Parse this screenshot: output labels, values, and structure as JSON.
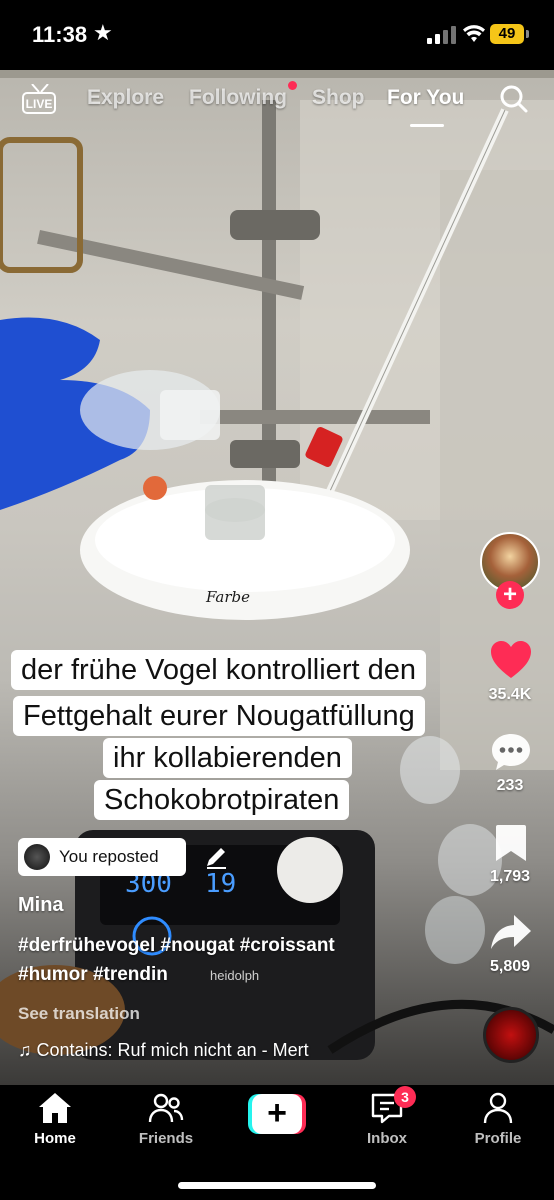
{
  "status_bar": {
    "time": "11:38",
    "battery": "49"
  },
  "top_nav": {
    "live_label": "LIVE",
    "tabs": [
      "Explore",
      "Following",
      "Shop",
      "For You"
    ],
    "active_tab": "For You"
  },
  "caption_lines": [
    "der frühe Vogel kontrolliert den",
    "Fettgehalt eurer Nougatfüllung",
    "ihr kollabierenden",
    "Schokobrotpiraten"
  ],
  "rail": {
    "likes": "35.4K",
    "comments": "233",
    "saves": "1,793",
    "shares": "5,809"
  },
  "video_text": {
    "hotplate_left": "300",
    "hotplate_right": "19",
    "brand": "heidolph",
    "handwriting": "Farbe"
  },
  "post": {
    "repost_label": "You reposted",
    "author": "Mina",
    "description_lines": [
      "#derfrühevogel #nougat #croissant",
      "#humor #trendin"
    ],
    "see_translation": "See translation",
    "sound": "Contains: Ruf mich nicht an - Mert"
  },
  "bottom_nav": {
    "items": [
      "Home",
      "Friends",
      "",
      "Inbox",
      "Profile"
    ],
    "inbox_badge": "3",
    "active": "Home"
  },
  "colors": {
    "accent_red": "#fe2c55",
    "accent_cyan": "#25f4ee",
    "battery": "#f5c518"
  }
}
